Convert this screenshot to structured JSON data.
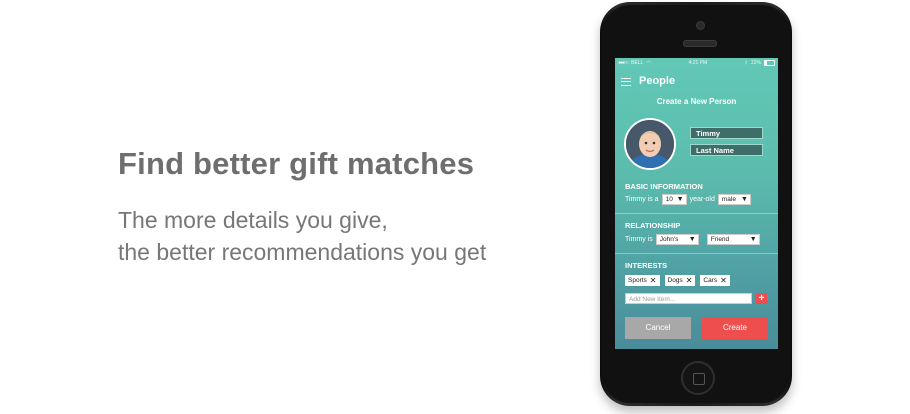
{
  "marketing": {
    "headline": "Find better gift matches",
    "subline1": "The more details you give,",
    "subline2": "the better recommendations you get"
  },
  "statusbar": {
    "carrier": "BELL",
    "time": "4:21 PM",
    "battery": "22%"
  },
  "app": {
    "nav_title": "People",
    "form_title": "Create a New Person",
    "first_name": "Timmy",
    "last_name_placeholder": "Last Name",
    "basic_info": {
      "heading": "BASIC INFORMATION",
      "prefix": "Timmy is a",
      "age_value": "10",
      "mid_text": "year-old",
      "gender_value": "male"
    },
    "relationship": {
      "heading": "RELATIONSHIP",
      "prefix": "Timmy is",
      "whose_value": "John's",
      "relation_value": "Friend"
    },
    "interests": {
      "heading": "INTERESTS",
      "chips": [
        "Sports",
        "Dogs",
        "Cars"
      ],
      "add_placeholder": "Add New Item...",
      "add_symbol": "+"
    },
    "actions": {
      "cancel": "Cancel",
      "create": "Create"
    }
  },
  "icons": {
    "select_arrow": "▼",
    "chip_remove": "✕"
  },
  "colors": {
    "accent_red": "#ef4e4e",
    "screen_teal": "#5bbcad"
  }
}
